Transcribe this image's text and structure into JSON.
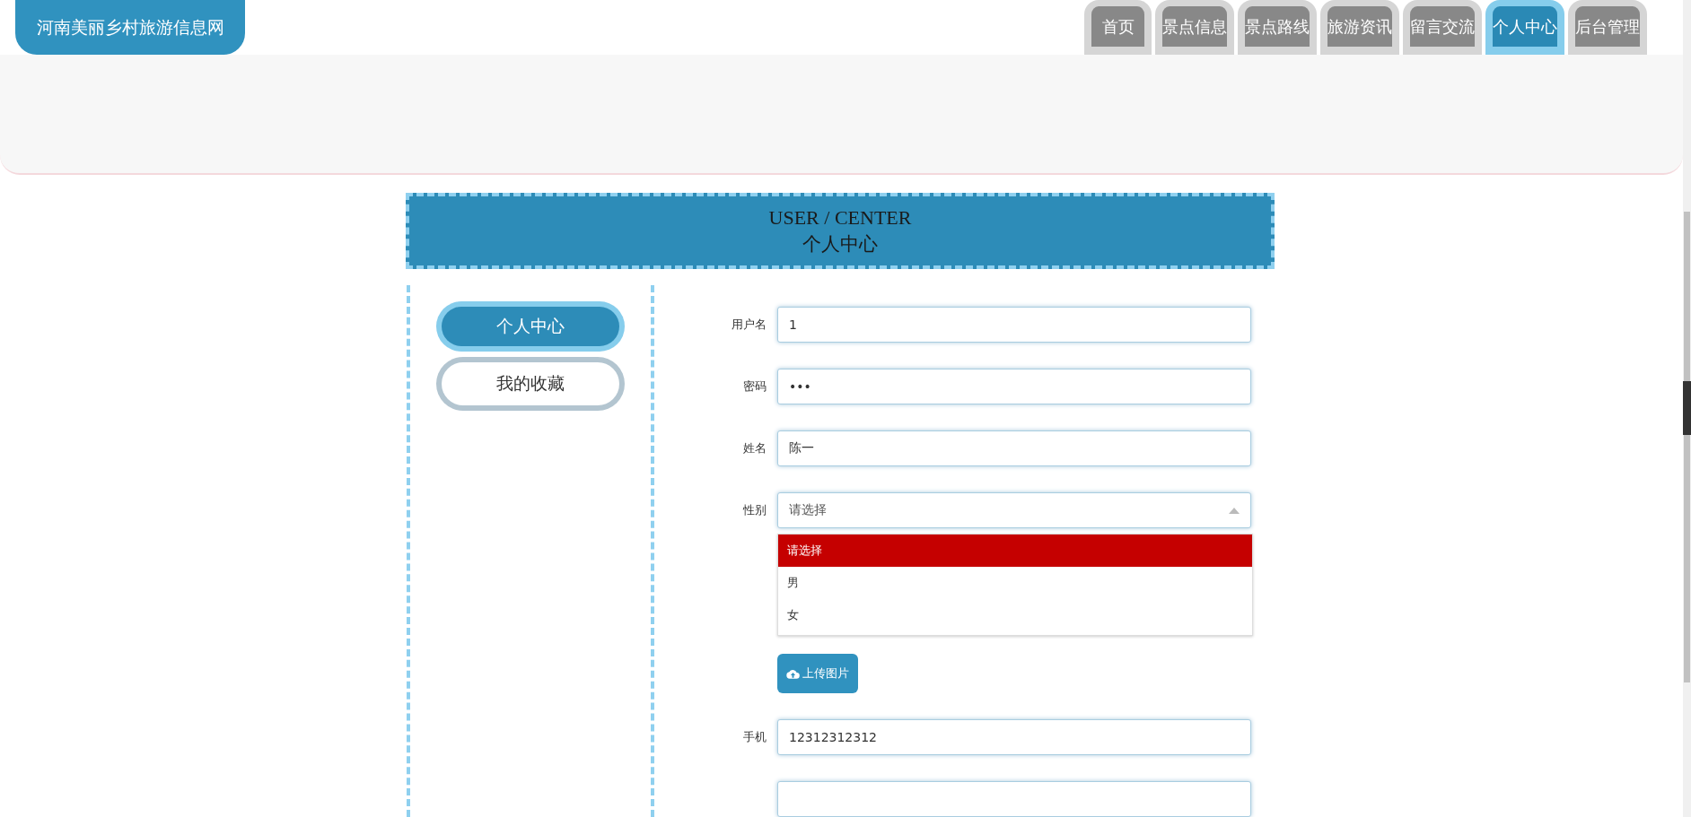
{
  "site_title": "河南美丽乡村旅游信息网",
  "nav": [
    {
      "label": "首页",
      "selected": false
    },
    {
      "label": "景点信息",
      "selected": false
    },
    {
      "label": "景点路线",
      "selected": false
    },
    {
      "label": "旅游资讯",
      "selected": false
    },
    {
      "label": "留言交流",
      "selected": false
    },
    {
      "label": "个人中心",
      "selected": true
    },
    {
      "label": "后台管理",
      "selected": false
    }
  ],
  "banner": {
    "title_en": "USER / CENTER",
    "title_cn": "个人中心"
  },
  "side_menu": [
    {
      "label": "个人中心",
      "selected": true
    },
    {
      "label": "我的收藏",
      "selected": false
    }
  ],
  "form": {
    "fields": [
      {
        "kind": "text",
        "label": "用户名",
        "value": "1"
      },
      {
        "kind": "text",
        "label": "密码",
        "value": "•••"
      },
      {
        "kind": "text",
        "label": "姓名",
        "value": "陈一"
      },
      {
        "kind": "select",
        "label": "性别",
        "value": "请选择",
        "expanded": true,
        "options": [
          {
            "label": "请选择",
            "selected": true
          },
          {
            "label": "男",
            "selected": false
          },
          {
            "label": "女",
            "selected": false
          }
        ]
      },
      {
        "kind": "upload",
        "label": "上传图片"
      },
      {
        "kind": "text",
        "label": "手机",
        "value": "12312312312"
      },
      {
        "kind": "text"
      }
    ]
  }
}
